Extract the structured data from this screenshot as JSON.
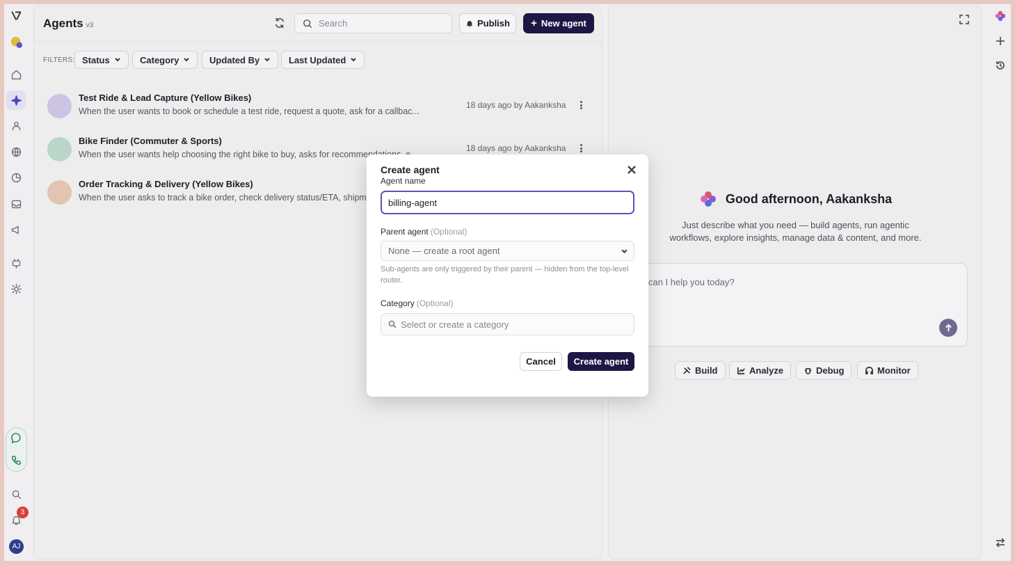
{
  "header": {
    "title": "Agents",
    "version": "v3"
  },
  "search": {
    "placeholder": "Search"
  },
  "actions": {
    "publish": "Publish",
    "new_agent": "New agent"
  },
  "filters": {
    "label": "FILTERS:",
    "items": [
      "Status",
      "Category",
      "Updated By",
      "Last Updated"
    ]
  },
  "agents": [
    {
      "name": "Test Ride & Lead Capture (Yellow Bikes)",
      "description": "When the user wants to book or schedule a test ride, request a quote, ask for a callbac...",
      "updated": "18 days ago by Aakanksha",
      "avatar_color": "#cdc3e2"
    },
    {
      "name": "Bike Finder (Commuter & Sports)",
      "description": "When the user wants help choosing the right bike to buy, asks for recommendations, e...",
      "updated": "18 days ago by Aakanksha",
      "avatar_color": "#b9d6c9"
    },
    {
      "name": "Order Tracking & Delivery (Yellow Bikes)",
      "description": "When the user asks to track a bike order, check delivery status/ETA, shipm",
      "updated": "",
      "avatar_color": "#e3c3b1"
    }
  ],
  "assistant": {
    "greeting": "Good afternoon, Aakanksha",
    "subtitle": "Just describe what you need — build agents, run agentic workflows, explore insights, manage data & content, and more.",
    "composer_placeholder": "can I help you today?",
    "chips": [
      "Build",
      "Analyze",
      "Debug",
      "Monitor"
    ]
  },
  "notifications": {
    "count": "3"
  },
  "user": {
    "initials": "AJ"
  },
  "modal": {
    "title": "Create agent",
    "name_label": "Agent name",
    "name_value": "billing-agent",
    "parent_label": "Parent agent",
    "parent_optional": "(Optional)",
    "parent_value": "None — create a root agent",
    "parent_hint": "Sub-agents are only triggered by their parent — hidden from the top-level router.",
    "category_label": "Category",
    "category_optional": "(Optional)",
    "category_placeholder": "Select or create a category",
    "cancel": "Cancel",
    "create": "Create agent"
  },
  "colors": {
    "primary": "#1c1744",
    "accent": "#4b44c6",
    "badge": "#d9403a"
  }
}
